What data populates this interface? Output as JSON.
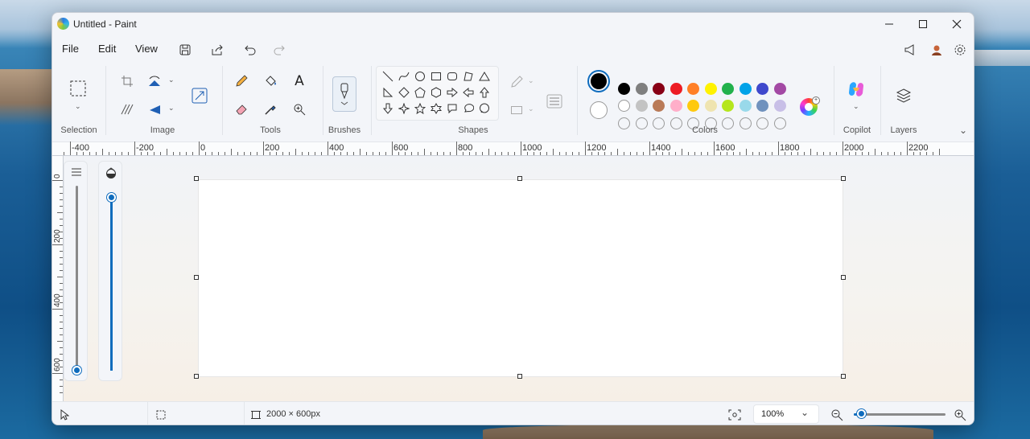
{
  "window": {
    "title": "Untitled - Paint"
  },
  "menu": {
    "file": "File",
    "edit": "Edit",
    "view": "View"
  },
  "ribbon": {
    "groups": {
      "selection": "Selection",
      "image": "Image",
      "tools": "Tools",
      "brushes": "Brushes",
      "shapes": "Shapes",
      "colors": "Colors",
      "copilot": "Copilot",
      "layers": "Layers"
    },
    "text_tool_glyph": "A"
  },
  "colors": {
    "primary": "#000000",
    "secondary": "#ffffff",
    "palette_row1": [
      "#000000",
      "#7f7f7f",
      "#880015",
      "#ed1c24",
      "#ff7f27",
      "#fff200",
      "#22b14c",
      "#00a2e8",
      "#3f48cc",
      "#a349a4"
    ],
    "palette_row2": [
      "#ffffff",
      "#c3c3c3",
      "#b97a57",
      "#ffaec9",
      "#ffc90e",
      "#efe4b0",
      "#b5e61d",
      "#99d9ea",
      "#7092be",
      "#c8bfe7"
    ],
    "palette_row3_custom_slots": 10,
    "accent": "#0f6cbd"
  },
  "ruler": {
    "horizontal_labels": [
      "-400",
      "-200",
      "0",
      "200",
      "400",
      "600",
      "800",
      "1000",
      "1200",
      "1400",
      "1600",
      "1800",
      "2000",
      "2200"
    ],
    "vertical_labels": [
      "0",
      "200",
      "400",
      "600"
    ]
  },
  "sliders": {
    "brush_size_level": 0.0,
    "opacity_level": 1.0
  },
  "canvas": {
    "size_label": "2000 × 600px"
  },
  "zoom": {
    "value": "100%",
    "level": 0.09
  }
}
